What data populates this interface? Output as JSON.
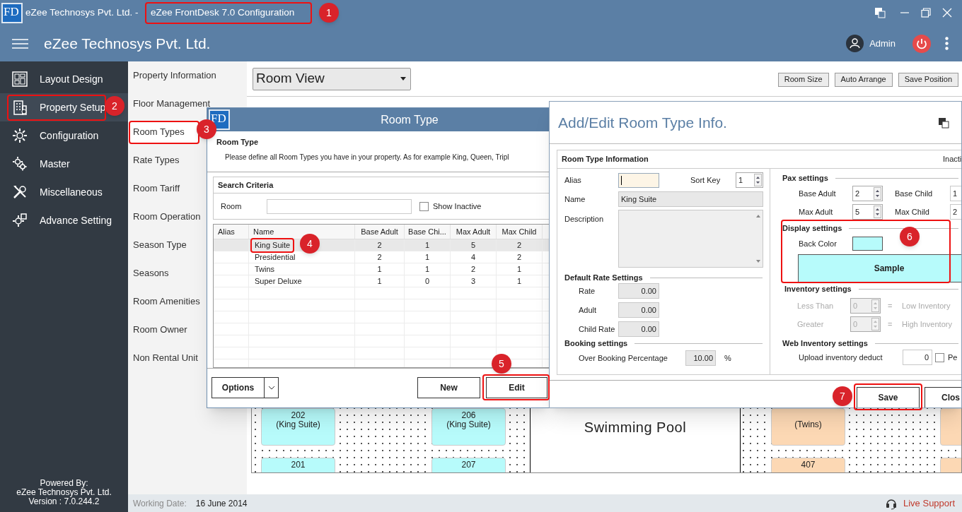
{
  "title_bar": {
    "logo": "FD",
    "company": "eZee Technosys Pvt. Ltd. -",
    "app_title": "eZee FrontDesk 7.0 Configuration"
  },
  "header": {
    "title": "eZee Technosys Pvt. Ltd.",
    "user": "Admin"
  },
  "sidebar": {
    "items": [
      {
        "label": "Layout Design",
        "selected": false
      },
      {
        "label": "Property Setup",
        "selected": true
      },
      {
        "label": "Configuration",
        "selected": false
      },
      {
        "label": "Master",
        "selected": false
      },
      {
        "label": "Miscellaneous",
        "selected": false
      },
      {
        "label": "Advance Setting",
        "selected": false
      }
    ],
    "footer": [
      "Powered By:",
      "eZee Technosys Pvt. Ltd.",
      "Version : 7.0.244.2"
    ]
  },
  "submenu": {
    "items": [
      {
        "label": "Property Information",
        "selected": false
      },
      {
        "label": "Floor Management",
        "selected": false
      },
      {
        "label": "Room Types",
        "selected": true
      },
      {
        "label": "Rate Types",
        "selected": false
      },
      {
        "label": "Room Tariff",
        "selected": false
      },
      {
        "label": "Room Operation",
        "selected": false
      },
      {
        "label": "Season Type",
        "selected": false
      },
      {
        "label": "Seasons",
        "selected": false
      },
      {
        "label": "Room Amenities",
        "selected": false
      },
      {
        "label": "Room Owner",
        "selected": false
      },
      {
        "label": "Non Rental Unit",
        "selected": false
      }
    ]
  },
  "toolbar": {
    "view": "Room View",
    "buttons": [
      "Room Size",
      "Auto Arrange",
      "Save Position"
    ]
  },
  "floor": {
    "area": "Swimming Pool",
    "rooms": [
      {
        "number": "202",
        "type": "(King Suite)",
        "color": "#b7fbfb"
      },
      {
        "number": "206",
        "type": "(King Suite)",
        "color": "#b7fbfb"
      },
      {
        "number": "201",
        "color": "#b7fbfb"
      },
      {
        "number": "207",
        "color": "#b7fbfb"
      },
      {
        "type": "(Twins)",
        "color": "#fcd8b4"
      },
      {
        "number": "407",
        "color": "#fcd8b4"
      },
      {
        "color": "#fcd8b4"
      },
      {
        "color": "#fcd8b4"
      }
    ]
  },
  "room_type_dialog": {
    "logo": "FD",
    "title": "Room Type",
    "heading": "Room Type",
    "description": "Please define all Room Types you have in your property. As for example King, Queen, Tripl",
    "search": {
      "title": "Search Criteria",
      "label": "Room",
      "show_inactive": {
        "label": "Show Inactive",
        "checked": false
      }
    },
    "columns": [
      "Alias",
      "Name",
      "Base Adult",
      "Base Chi...",
      "Max Adult",
      "Max Child"
    ],
    "rows": [
      {
        "name": "King Suite",
        "base_adult": "2",
        "base_child": "1",
        "max_adult": "5",
        "max_child": "2",
        "selected": true
      },
      {
        "name": "Presidential",
        "base_adult": "2",
        "base_child": "1",
        "max_adult": "4",
        "max_child": "2",
        "selected": false
      },
      {
        "name": "Twins",
        "base_adult": "1",
        "base_child": "1",
        "max_adult": "2",
        "max_child": "1",
        "selected": false
      },
      {
        "name": "Super Deluxe",
        "base_adult": "1",
        "base_child": "0",
        "max_adult": "3",
        "max_child": "1",
        "selected": false
      }
    ],
    "buttons": {
      "options": "Options",
      "new": "New",
      "edit": "Edit"
    }
  },
  "edit_dialog": {
    "title": "Add/Edit Room Type Info.",
    "group": "Room Type Information",
    "inactive": "Inacti",
    "alias": {
      "label": "Alias"
    },
    "sort_key": {
      "label": "Sort Key",
      "value": "1"
    },
    "name": {
      "label": "Name",
      "value": "King Suite"
    },
    "description": {
      "label": "Description"
    },
    "rate_title": "Default Rate Settings",
    "rates": [
      {
        "label": "Rate",
        "value": "0.00"
      },
      {
        "label": "Adult",
        "value": "0.00"
      },
      {
        "label": "Child Rate",
        "value": "0.00"
      }
    ],
    "booking": {
      "title": "Booking settings",
      "label": "Over Booking Percentage",
      "value": "10.00",
      "unit": "%"
    },
    "pax": {
      "title": "Pax settings",
      "fields": [
        {
          "label": "Base Adult",
          "value": "2"
        },
        {
          "label": "Base Child",
          "value": "1"
        },
        {
          "label": "Max Adult",
          "value": "5"
        },
        {
          "label": "Max Child",
          "value": "2"
        }
      ]
    },
    "display": {
      "title": "Display settings",
      "label": "Back Color",
      "color": "#b7fbfb",
      "sample": "Sample"
    },
    "inventory": {
      "title": "Inventory settings",
      "rows": [
        {
          "label": "Less Than",
          "value": "0",
          "sign": "=",
          "result": "Low Inventory",
          "disabled": true
        },
        {
          "label": "Greater",
          "value": "0",
          "sign": "=",
          "result": "High Inventory",
          "disabled": true
        }
      ]
    },
    "web": {
      "title": "Web Inventory settings",
      "label": "Upload inventory deduct",
      "value": "0",
      "checkbox": {
        "label": "Pe",
        "checked": false
      }
    },
    "buttons": [
      "Save",
      "Clos"
    ]
  },
  "status_bar": {
    "date_label": "Working Date:",
    "date": "16 June 2014",
    "support": "Live Support"
  },
  "annotations": [
    {
      "number": "1"
    },
    {
      "number": "2"
    },
    {
      "number": "3"
    },
    {
      "number": "4"
    },
    {
      "number": "5"
    },
    {
      "number": "6"
    },
    {
      "number": "7"
    }
  ]
}
